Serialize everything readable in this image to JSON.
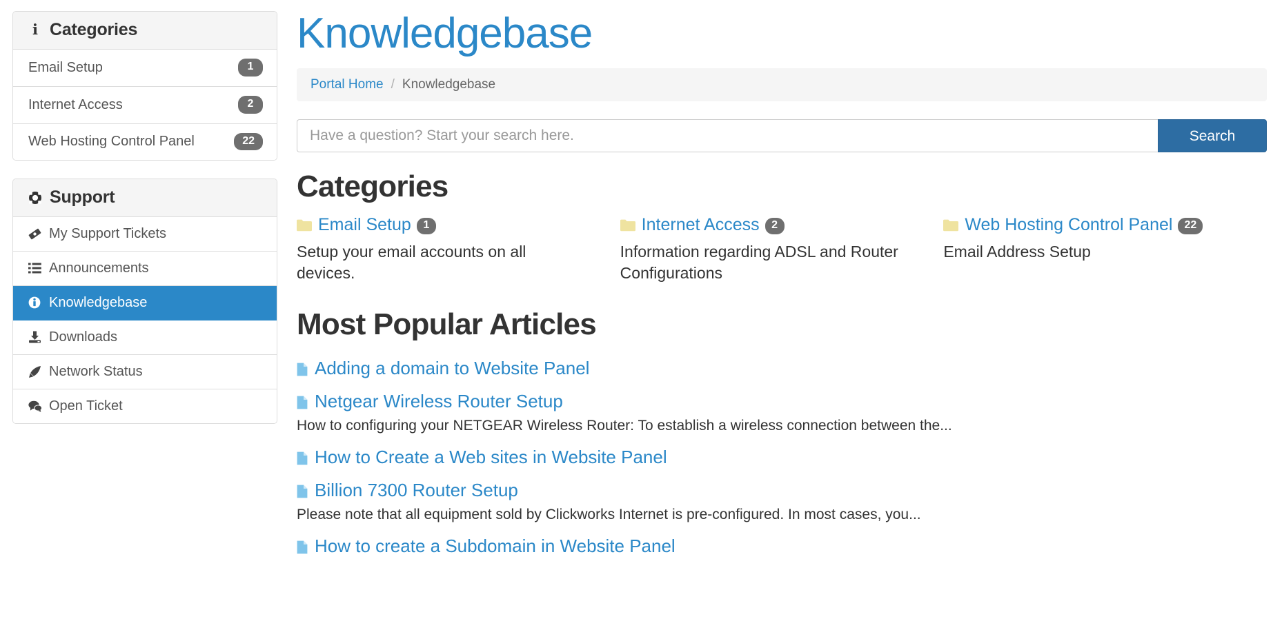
{
  "sidebar": {
    "categories_panel": {
      "title": "Categories",
      "icon": "info-icon",
      "items": [
        {
          "label": "Email Setup",
          "badge": "1"
        },
        {
          "label": "Internet Access",
          "badge": "2"
        },
        {
          "label": "Web Hosting Control Panel",
          "badge": "22"
        }
      ]
    },
    "support_panel": {
      "title": "Support",
      "icon": "lifebuoy-icon",
      "items": [
        {
          "label": "My Support Tickets",
          "icon": "ticket-icon",
          "active": false
        },
        {
          "label": "Announcements",
          "icon": "list-icon",
          "active": false
        },
        {
          "label": "Knowledgebase",
          "icon": "info-circle-icon",
          "active": true
        },
        {
          "label": "Downloads",
          "icon": "download-icon",
          "active": false
        },
        {
          "label": "Network Status",
          "icon": "rocket-icon",
          "active": false
        },
        {
          "label": "Open Ticket",
          "icon": "comments-icon",
          "active": false
        }
      ]
    }
  },
  "main": {
    "page_title": "Knowledgebase",
    "breadcrumb": {
      "home": "Portal Home",
      "separator": "/",
      "current": "Knowledgebase"
    },
    "search": {
      "placeholder": "Have a question? Start your search here.",
      "value": "",
      "button_label": "Search"
    },
    "categories_section": {
      "title": "Categories",
      "items": [
        {
          "name": "Email Setup",
          "badge": "1",
          "description": "Setup your email accounts on all devices."
        },
        {
          "name": "Internet Access",
          "badge": "2",
          "description": "Information regarding ADSL and Router Configurations"
        },
        {
          "name": "Web Hosting Control Panel",
          "badge": "22",
          "description": "Email Address Setup"
        }
      ]
    },
    "popular_section": {
      "title": "Most Popular Articles",
      "articles": [
        {
          "title": "Adding a domain to Website Panel",
          "excerpt": ""
        },
        {
          "title": "Netgear Wireless Router Setup",
          "excerpt": "How to configuring your NETGEAR Wireless Router: To establish a wireless connection between the..."
        },
        {
          "title": "How to Create a Web sites in Website Panel",
          "excerpt": ""
        },
        {
          "title": "Billion 7300 Router Setup",
          "excerpt": "Please note that all equipment sold by Clickworks Internet is pre-configured. In most cases, you..."
        },
        {
          "title": "How to create a Subdomain in Website Panel",
          "excerpt": ""
        }
      ]
    }
  },
  "colors": {
    "accent": "#2b88c8",
    "button": "#2d6da3",
    "badge": "#6f6f6f",
    "folder": "#efe3a0"
  }
}
